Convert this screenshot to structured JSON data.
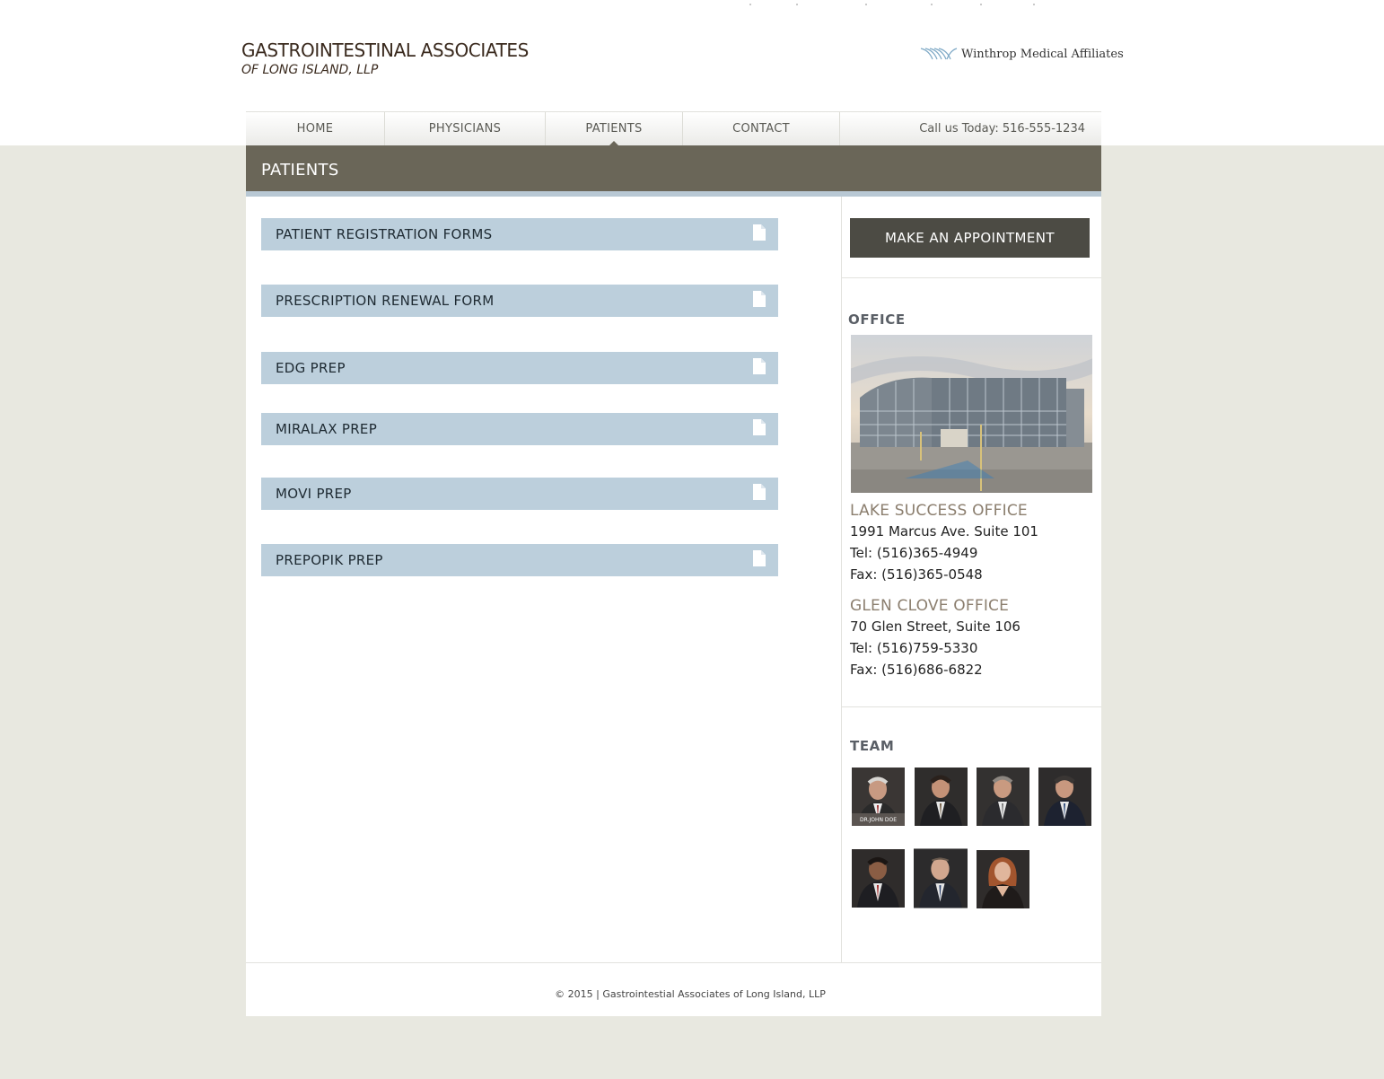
{
  "brand": {
    "line1": "GASTROINTESTINAL ASSOCIATES",
    "line2": "OF LONG ISLAND, LLP",
    "affiliate": "Winthrop Medical Affiliates"
  },
  "nav": {
    "items": [
      {
        "label": "HOME"
      },
      {
        "label": "PHYSICIANS"
      },
      {
        "label": "PATIENTS",
        "active": true
      },
      {
        "label": "CONTACT"
      }
    ],
    "phone": "Call us Today: 516-555-1234"
  },
  "page": {
    "title": "PATIENTS"
  },
  "documents": [
    {
      "label": "PATIENT REGISTRATION FORMS"
    },
    {
      "label": "PRESCRIPTION RENEWAL FORM"
    },
    {
      "label": "EDG PREP"
    },
    {
      "label": "MIRALAX PREP"
    },
    {
      "label": "MOVI PREP"
    },
    {
      "label": "PREPOPIK PREP"
    }
  ],
  "sidebar": {
    "appointment_button": "MAKE AN APPOINTMENT",
    "office_heading": "OFFICE",
    "offices": [
      {
        "name": "LAKE SUCCESS OFFICE",
        "address": "1991 Marcus Ave. Suite 101",
        "tel": "Tel: (516)365-4949",
        "fax": "Fax: (516)365-0548"
      },
      {
        "name": "GLEN CLOVE OFFICE",
        "address": "70 Glen Street, Suite 106",
        "tel": "Tel: (516)759-5330",
        "fax": "Fax: (516)686-6822"
      }
    ],
    "team_heading": "TEAM",
    "team_caption": "DR.JOHN DOE"
  },
  "footer": {
    "text": "© 2015 | Gastrointestial Associates of Long Island, LLP"
  },
  "colors": {
    "header_bar": "#6a6658",
    "doc_bar": "#bccfdc",
    "button": "#4c4b44",
    "office_name": "#8b7e6e",
    "background": "#e8e8e0"
  },
  "icons": [
    "document-icon",
    "winthrop-wings-icon"
  ]
}
